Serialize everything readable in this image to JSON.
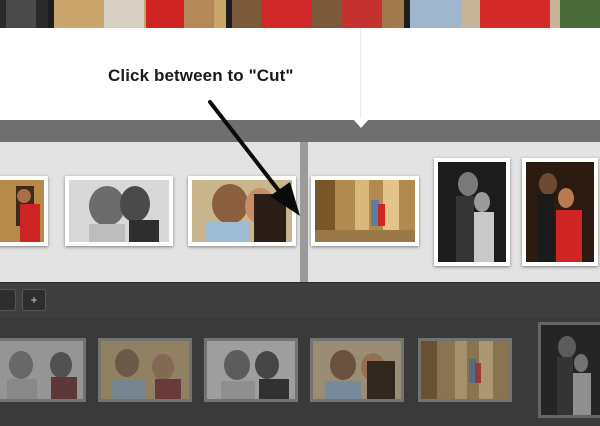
{
  "annotation": {
    "instruction": "Click between to \"Cut\""
  },
  "toolbar": {
    "left_button_label": "",
    "add_button_label": "+"
  },
  "thumbnail_pages": {
    "left_spread": [
      "photo-couple-woman-red-dress",
      "photo-couple-kiss-black-white",
      "photo-couple-kiss-color"
    ],
    "right_spread": [
      "photo-couple-walking-corridor",
      "photo-couple-dark-portrait",
      "photo-woman-red-dress-dark"
    ]
  },
  "library": {
    "photos": [
      "photo-couple-kiss-side",
      "photo-couple-smiling",
      "photo-couple-kiss-side-2",
      "photo-couple-kiss-close",
      "photo-couple-corridor",
      "photo-couple-dark-portrait"
    ]
  },
  "colors": {
    "spread_background": "#ffffff",
    "page_strip_background": "#e3e3e3",
    "separator_bar": "#6f6f6f",
    "cut_line": "#9a9a9a",
    "toolbar_background": "#3f3f3f",
    "library_background": "#3a3a3a",
    "dress_red": "#d42a2a",
    "annotation_text": "#1a1a1a"
  }
}
